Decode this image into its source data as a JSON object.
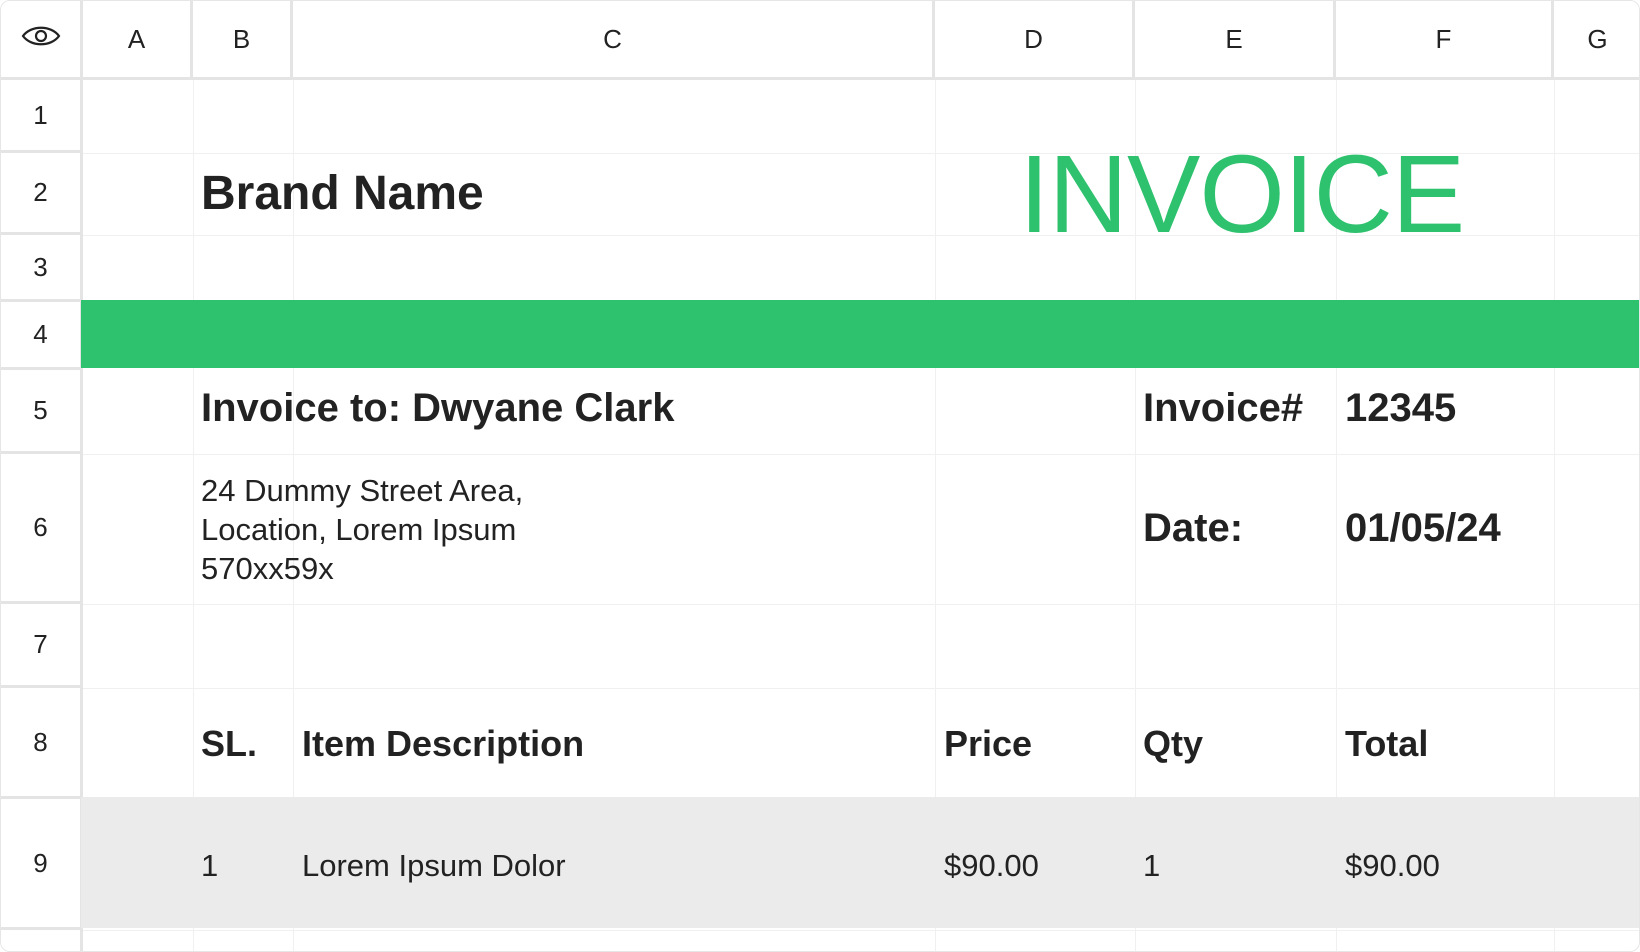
{
  "sheet": {
    "columns": [
      "A",
      "B",
      "C",
      "D",
      "E",
      "F",
      "G"
    ],
    "rows": [
      "1",
      "2",
      "3",
      "4",
      "5",
      "6",
      "7",
      "8",
      "9"
    ],
    "icons": {
      "corner": "eye-icon"
    }
  },
  "invoice": {
    "brand": "Brand Name",
    "title": "INVOICE",
    "invoice_to": "Invoice to: Dwyane Clark",
    "address": "24 Dummy Street Area,\nLocation, Lorem Ipsum\n570xx59x",
    "invoice_no_label": "Invoice#",
    "invoice_no": "12345",
    "date_label": "Date:",
    "date": "01/05/24",
    "table_headers": [
      "SL.",
      "Item Description",
      "Price",
      "Qty",
      "Total"
    ],
    "items": [
      {
        "sl": "1",
        "description": "Lorem Ipsum Dolor",
        "price": "$90.00",
        "qty": "1",
        "total": "$90.00"
      }
    ]
  },
  "colors": {
    "accent": "#2ec16e",
    "row_highlight": "#ebebeb",
    "grid": "#e4e4e4"
  }
}
